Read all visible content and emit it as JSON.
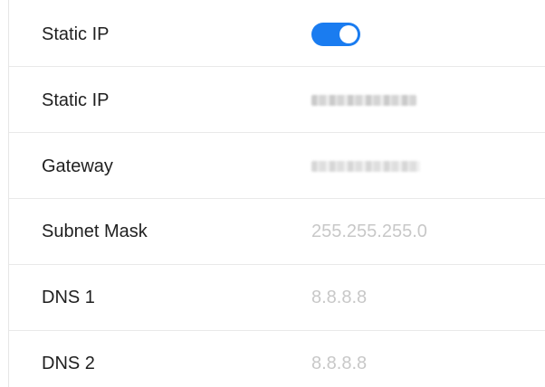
{
  "colors": {
    "accent": "#1a7cf0",
    "divider": "#e9e9e9",
    "value_text": "#c8c8c8",
    "label_text": "#1f1f1f"
  },
  "settings": {
    "static_ip_toggle": {
      "label": "Static IP",
      "enabled": true
    },
    "static_ip": {
      "label": "Static IP",
      "value_obscured": true
    },
    "gateway": {
      "label": "Gateway",
      "value_obscured": true
    },
    "subnet_mask": {
      "label": "Subnet Mask",
      "value": "255.255.255.0"
    },
    "dns1": {
      "label": "DNS 1",
      "value": "8.8.8.8"
    },
    "dns2": {
      "label": "DNS 2",
      "value": "8.8.8.8"
    }
  }
}
